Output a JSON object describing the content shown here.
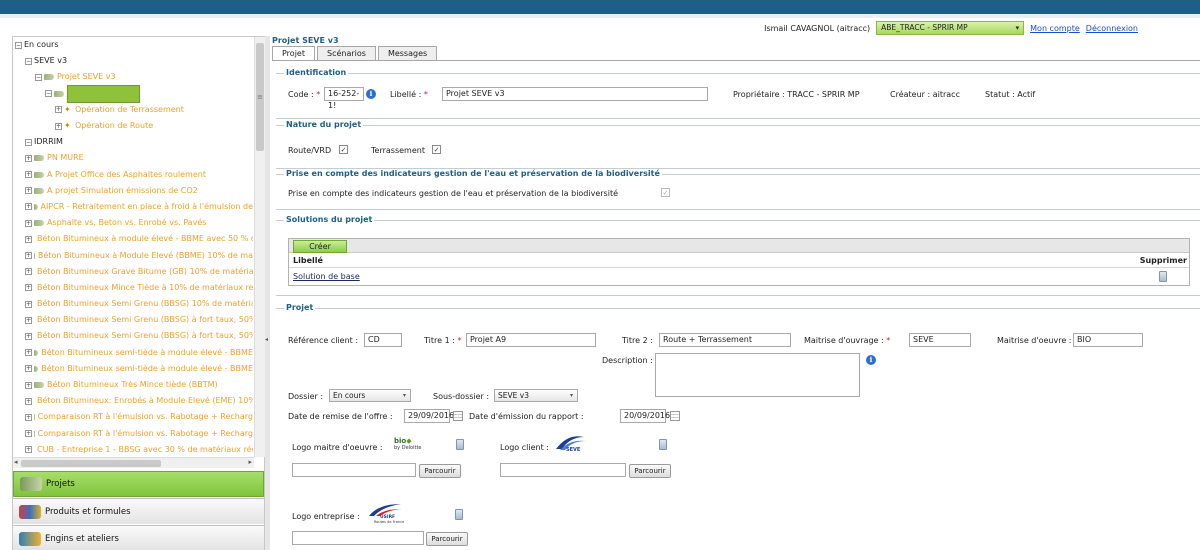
{
  "header": {
    "user": "Ismail CAVAGNOL (aitracc)",
    "role": "ABE_TRACC - SPRIR MP",
    "links": [
      "Mon compte",
      "Déconnexion"
    ]
  },
  "tree": {
    "rows": [
      {
        "label": "En cours",
        "style": "black",
        "indent": 0
      },
      {
        "label": "SEVE v3",
        "style": "black",
        "indent": 1
      },
      {
        "label": "Projet SEVE v3",
        "style": "orange",
        "indent": 2
      },
      {
        "label": "Solution de base",
        "style": "selected",
        "indent": 3
      },
      {
        "label": "Opération de Terrassement",
        "style": "orange",
        "indent": 4
      },
      {
        "label": "Opération de Route",
        "style": "orange",
        "indent": 4
      },
      {
        "label": "IDRRIM",
        "style": "black",
        "indent": 1
      },
      {
        "label": "PN MURE",
        "style": "orange",
        "indent": 1
      },
      {
        "label": "A Projet Office des Asphaltes roulement",
        "style": "orange",
        "indent": 1
      },
      {
        "label": "A projet Simulation émissions de CO2",
        "style": "orange",
        "indent": 1
      },
      {
        "label": "AIPCR - Retraitement en place à froid à l'émulsion de",
        "style": "orange",
        "indent": 1
      },
      {
        "label": "Asphalte vs. Beton vs. Enrobé vs. Pavés",
        "style": "orange",
        "indent": 1
      },
      {
        "label": "Béton Bitumineux à module élevé - BBME avec 50 % d",
        "style": "orange",
        "indent": 1
      },
      {
        "label": "Béton Bitumineux à Module Elevé (BBME) 10% de ma",
        "style": "orange",
        "indent": 1
      },
      {
        "label": "Béton Bitumineux Grave Bitume (GB) 10% de matéria",
        "style": "orange",
        "indent": 1
      },
      {
        "label": "Béton Bitumineux Mince Tiède à 10% de matériaux re",
        "style": "orange",
        "indent": 1
      },
      {
        "label": "Béton Bitumineux Semi Grenu (BBSG) 10% de matéria",
        "style": "orange",
        "indent": 1
      },
      {
        "label": "Béton Bitumineux Semi Grenu (BBSG) à fort taux, 50%",
        "style": "orange",
        "indent": 1
      },
      {
        "label": "Béton Bitumineux Semi Grenu (BBSG) à fort taux, 50%",
        "style": "orange",
        "indent": 1
      },
      {
        "label": "Béton Bitumineux semi-tiède à module élevé - BBME",
        "style": "orange",
        "indent": 1
      },
      {
        "label": "Béton Bitumineux semi-tiède à module élevé - BBME",
        "style": "orange",
        "indent": 1
      },
      {
        "label": "Béton Bitumineux Très Mince tiède (BBTM)",
        "style": "orange",
        "indent": 1
      },
      {
        "label": "Béton Bitumineux: Enrobés à Module Elevé (EME) 10%",
        "style": "orange",
        "indent": 1
      },
      {
        "label": "Comparaison RT à l'émulsion vs. Rabotage + Recharg",
        "style": "orange",
        "indent": 1
      },
      {
        "label": "Comparaison RT à l'émulsion vs. Rabotage + Recharg",
        "style": "orange",
        "indent": 1
      },
      {
        "label": "CUB - Entreprise 1 - BBSG avec 30 % de matériaux réc",
        "style": "orange",
        "indent": 1
      },
      {
        "label": "CUB - Entreprise 2 - BBSG avec 10% de matériaux rec",
        "style": "orange",
        "indent": 1
      }
    ]
  },
  "left_menu": {
    "items": [
      {
        "label": "Projets",
        "active": true
      },
      {
        "label": "Produits et formules",
        "active": false
      },
      {
        "label": "Engins et ateliers",
        "active": false
      }
    ]
  },
  "main": {
    "title": "Projet SEVE v3",
    "tabs": [
      "Projet",
      "Scénarios",
      "Messages"
    ]
  },
  "identification": {
    "title": "Identification",
    "code_label": "Code :",
    "code_value": "16-252-1!",
    "libelle_label": "Libellé :",
    "libelle_value": "Projet SEVE v3",
    "proprietaire": "Propriétaire : TRACC - SPRIR MP",
    "createur": "Créateur : aitracc",
    "statut": "Statut : Actif"
  },
  "nature": {
    "title": "Nature du projet",
    "route_label": "Route/VRD",
    "terrassement_label": "Terrassement"
  },
  "indicateurs": {
    "title": "Prise en compte des indicateurs gestion de l'eau et préservation de la biodiversité",
    "label": "Prise en compte des indicateurs gestion de l'eau et préservation de la biodiversité"
  },
  "solutions": {
    "title": "Solutions du projet",
    "create_label": "Créer",
    "col_libelle": "Libellé",
    "col_supprimer": "Supprimer",
    "rows": [
      "Solution de base"
    ]
  },
  "projet": {
    "title": "Projet",
    "ref_client_label": "Référence client :",
    "ref_client_value": "CD",
    "titre1_label": "Titre 1 :",
    "titre1_value": "Projet A9",
    "titre2_label": "Titre 2 :",
    "titre2_value": "Route + Terrassement",
    "mo_label": "Maitrise d'ouvrage :",
    "mo_value": "SEVE",
    "moe_label": "Maitrise d'oeuvre :",
    "moe_value": "BIO",
    "description_label": "Description :",
    "dossier_label": "Dossier :",
    "dossier_value": "En cours",
    "sous_dossier_label": "Sous-dossier :",
    "sous_dossier_value": "SEVE v3",
    "date_remise_label": "Date de remise de l'offre :",
    "date_remise_value": "29/09/2016",
    "date_emission_label": "Date d'émission du rapport :",
    "date_emission_value": "20/09/2016",
    "logo_moe_label": "Logo maitre d'oeuvre :",
    "logo_client_label": "Logo client :",
    "logo_entreprise_label": "Logo entreprise :",
    "browse_label": "Parcourir",
    "logo_bio_text": "bio",
    "logo_bio_sub": "by Deloitte",
    "logo_seve_text": "SEVE",
    "logo_usirf_text": "USIRF",
    "logo_usirf_sub": "Routes de France"
  }
}
